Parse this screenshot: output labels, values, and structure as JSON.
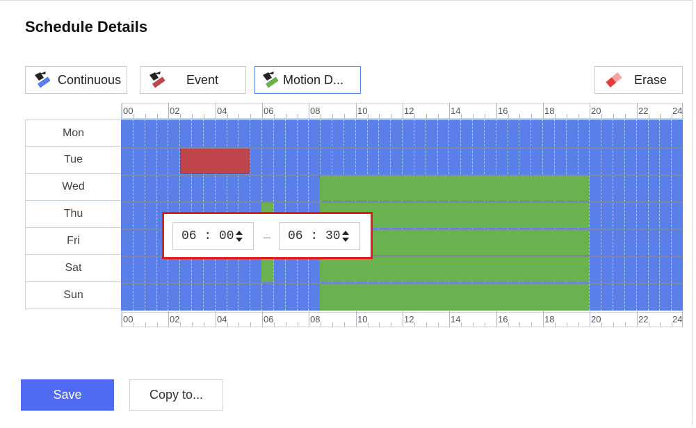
{
  "title": "Schedule Details",
  "toolbar": {
    "continuous": {
      "label": "Continuous",
      "icon": "brush-blue-icon"
    },
    "event": {
      "label": "Event",
      "icon": "brush-red-icon"
    },
    "motion": {
      "label": "Motion D...",
      "icon": "brush-green-icon"
    },
    "erase": {
      "label": "Erase",
      "icon": "eraser-icon"
    }
  },
  "hours": [
    "00",
    "02",
    "04",
    "06",
    "08",
    "10",
    "12",
    "14",
    "16",
    "18",
    "20",
    "22",
    "24"
  ],
  "days": [
    "Mon",
    "Tue",
    "Wed",
    "Thu",
    "Fri",
    "Sat",
    "Sun"
  ],
  "colors": {
    "continuous": "#5b7fe8",
    "event": "#c0454a",
    "motion": "#6ab150",
    "accent": "#4f6bf2",
    "highlight": "#e31b14"
  },
  "time_popup": {
    "start": "06 : 00",
    "end": "06 : 30",
    "separator": "–"
  },
  "buttons": {
    "save": "Save",
    "copy": "Copy to..."
  }
}
